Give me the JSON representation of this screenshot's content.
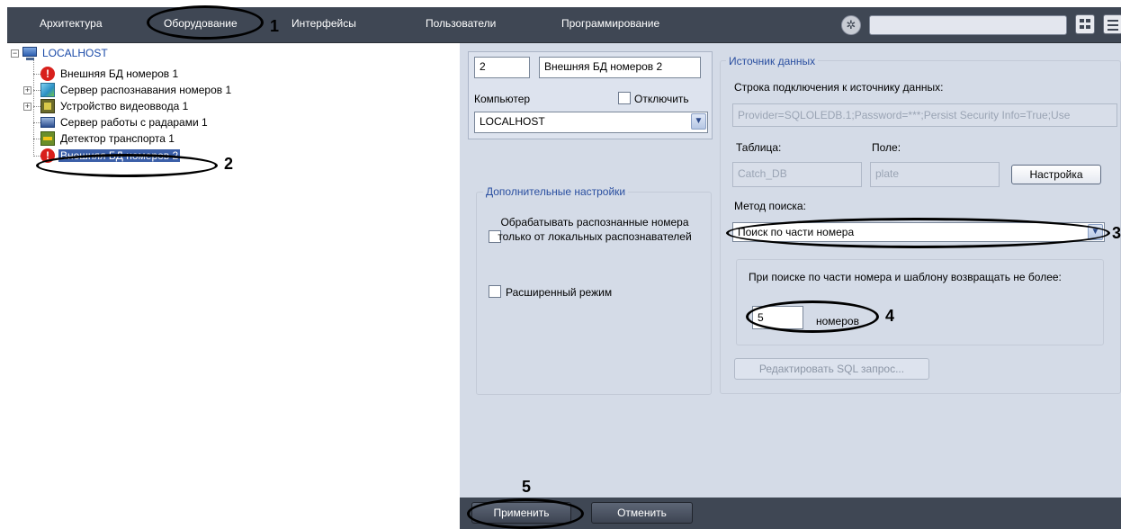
{
  "nav": {
    "items": [
      "Архитектура",
      "Оборудование",
      "Интерфейсы",
      "Пользователи",
      "Программирование"
    ]
  },
  "tree": {
    "root": "LOCALHOST",
    "children": [
      "Внешняя БД номеров 1",
      "Сервер распознавания номеров 1",
      "Устройство видеоввода 1",
      "Сервер работы с радарами 1",
      "Детектор транспорта 1",
      "Внешняя БД номеров 2"
    ],
    "selected_index": 5
  },
  "object": {
    "id": "2",
    "name": "Внешняя БД номеров 2",
    "computer_label": "Компьютер",
    "disable_label": "Отключить",
    "computer_value": "LOCALHOST"
  },
  "extra": {
    "title": "Дополнительные настройки",
    "local_only_label": "Обрабатывать распознанные номера только от локальных распознавателей",
    "extended_mode_label": "Расширенный режим"
  },
  "source": {
    "title": "Источник данных",
    "connection_label": "Строка подключения к источнику данных:",
    "connection_value": "Provider=SQLOLEDB.1;Password=***;Persist Security Info=True;Use",
    "table_label": "Таблица:",
    "field_label": "Поле:",
    "table_value": "Catch_DB",
    "field_value": "plate",
    "setup_button": "Настройка",
    "search_method_label": "Метод поиска:",
    "search_method_value": "Поиск по части номера",
    "limit_text": "При поиске по части номера и шаблону возвращать не более:",
    "limit_value": "5",
    "limit_unit": "номеров",
    "edit_sql_button": "Редактировать SQL запрос..."
  },
  "footer": {
    "apply": "Применить",
    "cancel": "Отменить"
  },
  "callouts": [
    "1",
    "2",
    "3",
    "4",
    "5"
  ]
}
